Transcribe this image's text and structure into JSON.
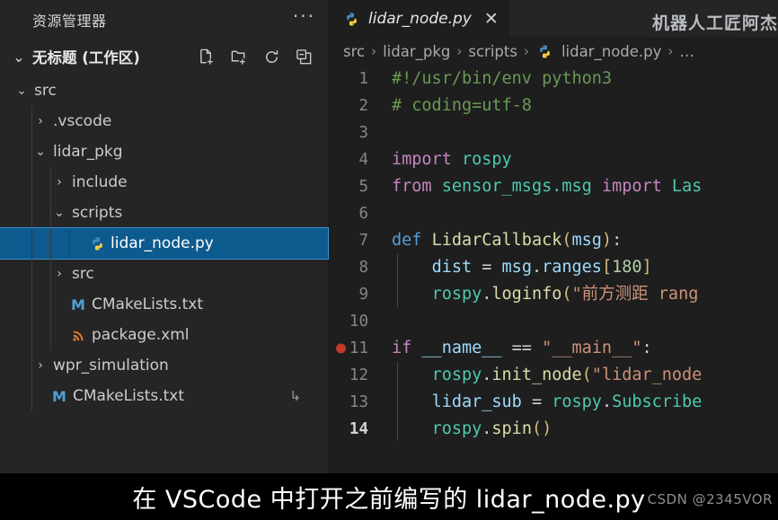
{
  "sidebar": {
    "header_title": "资源管理器",
    "more_actions": "···",
    "workspace": {
      "label": "无标题 (工作区)",
      "twisty": "⌄",
      "actions": [
        {
          "name": "new-file-icon",
          "label": "新建文件"
        },
        {
          "name": "new-folder-icon",
          "label": "新建文件夹"
        },
        {
          "name": "refresh-icon",
          "label": "刷新资源管理器"
        },
        {
          "name": "collapse-all-icon",
          "label": "在资源管理器中折叠文件夹"
        }
      ]
    },
    "tree": [
      {
        "label": "src",
        "chev": "⌄",
        "indent": 1,
        "type": "folder",
        "selected": false
      },
      {
        "label": ".vscode",
        "chev": "›",
        "indent": 2,
        "type": "folder",
        "selected": false
      },
      {
        "label": "lidar_pkg",
        "chev": "⌄",
        "indent": 2,
        "type": "folder",
        "selected": false
      },
      {
        "label": "include",
        "chev": "›",
        "indent": 3,
        "type": "folder",
        "selected": false
      },
      {
        "label": "scripts",
        "chev": "⌄",
        "indent": 3,
        "type": "folder",
        "selected": false
      },
      {
        "label": "lidar_node.py",
        "chev": "",
        "indent": 4,
        "type": "python",
        "selected": true
      },
      {
        "label": "src",
        "chev": "›",
        "indent": 3,
        "type": "folder",
        "selected": false
      },
      {
        "label": "CMakeLists.txt",
        "chev": "",
        "indent": 3,
        "type": "cmake",
        "selected": false
      },
      {
        "label": "package.xml",
        "chev": "",
        "indent": 3,
        "type": "xml",
        "selected": false
      },
      {
        "label": "wpr_simulation",
        "chev": "›",
        "indent": 2,
        "type": "folder",
        "selected": false
      },
      {
        "label": "CMakeLists.txt",
        "chev": "",
        "indent": 2,
        "type": "cmake",
        "selected": false,
        "trailing": "↳"
      }
    ]
  },
  "editor": {
    "tab": {
      "title": "lidar_node.py",
      "close": "✕",
      "icon": "python-icon"
    },
    "watermark_top": "机器人工匠阿杰",
    "breadcrumb": [
      "src",
      "lidar_pkg",
      "scripts",
      "lidar_node.py",
      "…"
    ],
    "breadcrumb_sep": "›",
    "active_line": 14,
    "breakpoint_line": 11,
    "lines": [
      {
        "n": 1,
        "tokens": [
          {
            "t": "#!/usr/bin/env python3",
            "c": "c-com"
          }
        ]
      },
      {
        "n": 2,
        "tokens": [
          {
            "t": "# coding=utf-8",
            "c": "c-com"
          }
        ]
      },
      {
        "n": 3,
        "tokens": []
      },
      {
        "n": 4,
        "tokens": [
          {
            "t": "import",
            "c": "c-kw2"
          },
          {
            "t": " ",
            "c": "c-op"
          },
          {
            "t": "rospy",
            "c": "c-ns"
          }
        ]
      },
      {
        "n": 5,
        "tokens": [
          {
            "t": "from",
            "c": "c-kw2"
          },
          {
            "t": " ",
            "c": "c-op"
          },
          {
            "t": "sensor_msgs.msg",
            "c": "c-ns"
          },
          {
            "t": " ",
            "c": "c-op"
          },
          {
            "t": "import",
            "c": "c-kw2"
          },
          {
            "t": " ",
            "c": "c-op"
          },
          {
            "t": "Las",
            "c": "c-ns"
          }
        ]
      },
      {
        "n": 6,
        "tokens": []
      },
      {
        "n": 7,
        "tokens": [
          {
            "t": "def",
            "c": "c-kw"
          },
          {
            "t": " ",
            "c": "c-op"
          },
          {
            "t": "LidarCallback",
            "c": "c-fn"
          },
          {
            "t": "(",
            "c": "c-par"
          },
          {
            "t": "msg",
            "c": "c-var"
          },
          {
            "t": ")",
            "c": "c-par"
          },
          {
            "t": ":",
            "c": "c-op"
          }
        ]
      },
      {
        "n": 8,
        "tokens": [
          {
            "t": "    ",
            "c": "c-op"
          },
          {
            "t": "dist",
            "c": "c-var"
          },
          {
            "t": " = ",
            "c": "c-op"
          },
          {
            "t": "msg",
            "c": "c-var"
          },
          {
            "t": ".",
            "c": "c-op"
          },
          {
            "t": "ranges",
            "c": "c-var"
          },
          {
            "t": "[",
            "c": "c-brk"
          },
          {
            "t": "180",
            "c": "c-num"
          },
          {
            "t": "]",
            "c": "c-brk"
          }
        ]
      },
      {
        "n": 9,
        "tokens": [
          {
            "t": "    ",
            "c": "c-op"
          },
          {
            "t": "rospy",
            "c": "c-ns"
          },
          {
            "t": ".",
            "c": "c-op"
          },
          {
            "t": "loginfo",
            "c": "c-fn"
          },
          {
            "t": "(",
            "c": "c-par"
          },
          {
            "t": "\"前方测距 rang",
            "c": "c-str"
          }
        ]
      },
      {
        "n": 10,
        "tokens": []
      },
      {
        "n": 11,
        "tokens": [
          {
            "t": "if",
            "c": "c-kw2"
          },
          {
            "t": " ",
            "c": "c-op"
          },
          {
            "t": "__name__",
            "c": "c-var"
          },
          {
            "t": " == ",
            "c": "c-op"
          },
          {
            "t": "\"__main__\"",
            "c": "c-str"
          },
          {
            "t": ":",
            "c": "c-op"
          }
        ]
      },
      {
        "n": 12,
        "tokens": [
          {
            "t": "    ",
            "c": "c-op"
          },
          {
            "t": "rospy",
            "c": "c-ns"
          },
          {
            "t": ".",
            "c": "c-op"
          },
          {
            "t": "init_node",
            "c": "c-fn"
          },
          {
            "t": "(",
            "c": "c-par"
          },
          {
            "t": "\"lidar_node",
            "c": "c-str"
          }
        ]
      },
      {
        "n": 13,
        "tokens": [
          {
            "t": "    ",
            "c": "c-op"
          },
          {
            "t": "lidar_sub",
            "c": "c-var"
          },
          {
            "t": " = ",
            "c": "c-op"
          },
          {
            "t": "rospy",
            "c": "c-ns"
          },
          {
            "t": ".",
            "c": "c-op"
          },
          {
            "t": "Subscribe",
            "c": "c-ns"
          }
        ]
      },
      {
        "n": 14,
        "tokens": [
          {
            "t": "    ",
            "c": "c-op"
          },
          {
            "t": "rospy",
            "c": "c-ns"
          },
          {
            "t": ".",
            "c": "c-op"
          },
          {
            "t": "spin",
            "c": "c-fn"
          },
          {
            "t": "(",
            "c": "c-par"
          },
          {
            "t": ")",
            "c": "c-par"
          }
        ]
      }
    ]
  },
  "caption": {
    "text": "在 VSCode 中打开之前编写的 lidar_node.py",
    "watermark": "CSDN @2345VOR"
  },
  "colors": {
    "sidebar_bg": "#252526",
    "editor_bg": "#1e1e1e",
    "selection_blue": "#0d5a8f",
    "selection_border": "#3794d2",
    "python_blue": "#3c78aa",
    "cmake_blue": "#4ea0d1",
    "xml_orange": "#e07a2f",
    "breakpoint_red": "#c0392b"
  }
}
